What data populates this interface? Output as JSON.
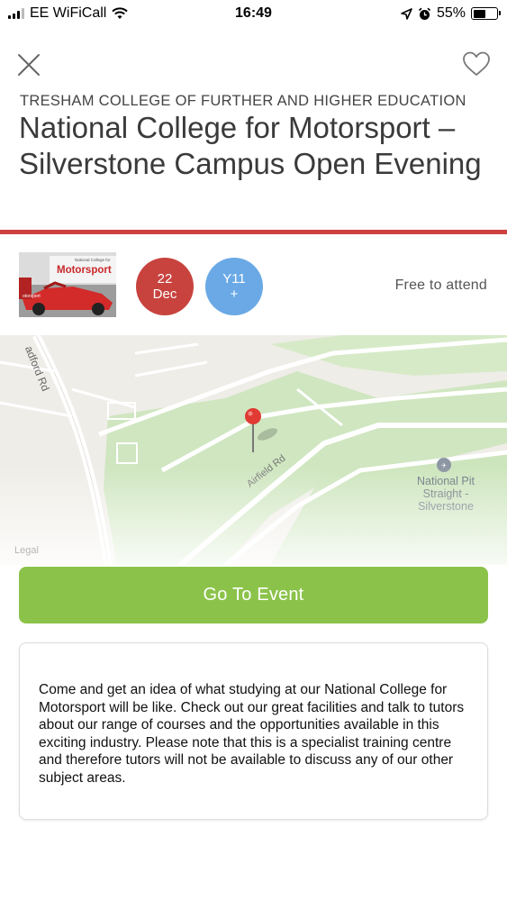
{
  "status_bar": {
    "carrier": "EE WiFiCall",
    "time": "16:49",
    "battery": "55%",
    "battery_level": 0.55,
    "icons": [
      "signal-icon",
      "wifi-icon",
      "location-arrow-icon",
      "alarm-icon",
      "battery-icon"
    ]
  },
  "header": {
    "organization": "TRESHAM COLLEGE OF FURTHER AND HIGHER EDUCATION",
    "title": "National College for Motorsport – Silverstone Campus Open Evening",
    "accent_color": "#cf4040"
  },
  "event_info": {
    "date_day": "22",
    "date_month": "Dec",
    "date_color": "#c8433e",
    "year_line1": "Y11",
    "year_line2": "+",
    "year_color": "#6aa9e6",
    "price": "Free to attend",
    "thumbnail_text": "Motorsport",
    "thumbnail_caption": "National College for",
    "thumbnail_car_text": "otorsport"
  },
  "map": {
    "road_label_1": "adford Rd",
    "road_label_2": "Airfield Rd",
    "poi_label_line1": "National Pit",
    "poi_label_line2": "Straight -",
    "poi_label_line3": "Silverstone",
    "legal": "Legal"
  },
  "cta": {
    "label": "Go To Event",
    "color": "#8bc34a"
  },
  "description": {
    "text": "Come and get an idea of what studying at our National College for Motorsport will be like. Check out our great facilities and talk to tutors about our range of courses and the opportunities available in this exciting industry.  Please note that this is a specialist training centre and therefore tutors will not be available to discuss any of our other subject areas."
  }
}
